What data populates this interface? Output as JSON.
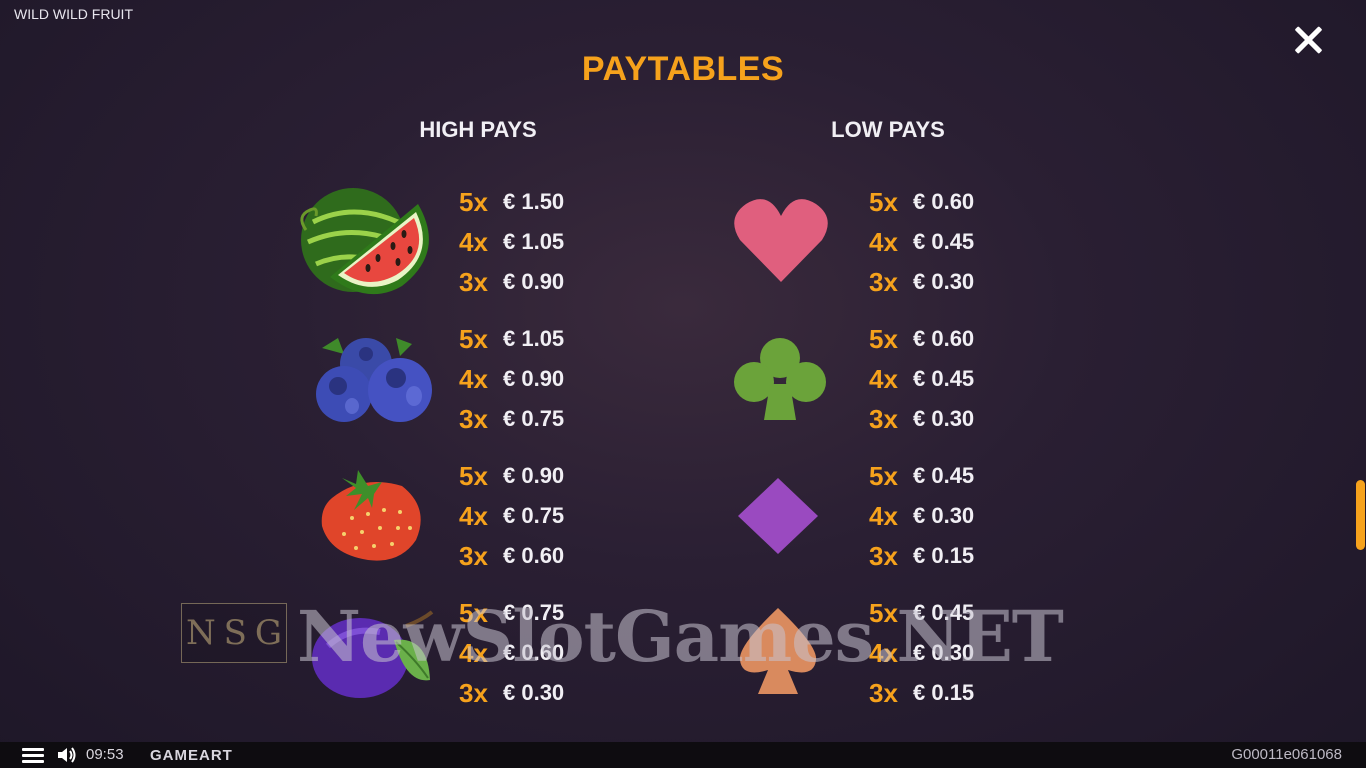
{
  "window": {
    "title": "WILD WILD FRUIT"
  },
  "page": {
    "title": "PAYTABLES"
  },
  "high_pays": {
    "title": "HIGH PAYS",
    "symbols": [
      {
        "icon": "watermelon-icon",
        "rows": [
          {
            "mult": "5x",
            "amount": "€ 1.50"
          },
          {
            "mult": "4x",
            "amount": "€ 1.05"
          },
          {
            "mult": "3x",
            "amount": "€ 0.90"
          }
        ]
      },
      {
        "icon": "blueberries-icon",
        "rows": [
          {
            "mult": "5x",
            "amount": "€ 1.05"
          },
          {
            "mult": "4x",
            "amount": "€ 0.90"
          },
          {
            "mult": "3x",
            "amount": "€ 0.75"
          }
        ]
      },
      {
        "icon": "strawberry-icon",
        "rows": [
          {
            "mult": "5x",
            "amount": "€ 0.90"
          },
          {
            "mult": "4x",
            "amount": "€ 0.75"
          },
          {
            "mult": "3x",
            "amount": "€ 0.60"
          }
        ]
      },
      {
        "icon": "plum-icon",
        "rows": [
          {
            "mult": "5x",
            "amount": "€ 0.75"
          },
          {
            "mult": "4x",
            "amount": "€ 0.60"
          },
          {
            "mult": "3x",
            "amount": "€ 0.30"
          }
        ]
      }
    ]
  },
  "low_pays": {
    "title": "LOW PAYS",
    "symbols": [
      {
        "icon": "heart-icon",
        "rows": [
          {
            "mult": "5x",
            "amount": "€ 0.60"
          },
          {
            "mult": "4x",
            "amount": "€ 0.45"
          },
          {
            "mult": "3x",
            "amount": "€ 0.30"
          }
        ]
      },
      {
        "icon": "club-icon",
        "rows": [
          {
            "mult": "5x",
            "amount": "€ 0.60"
          },
          {
            "mult": "4x",
            "amount": "€ 0.45"
          },
          {
            "mult": "3x",
            "amount": "€ 0.30"
          }
        ]
      },
      {
        "icon": "diamond-icon",
        "rows": [
          {
            "mult": "5x",
            "amount": "€ 0.45"
          },
          {
            "mult": "4x",
            "amount": "€ 0.30"
          },
          {
            "mult": "3x",
            "amount": "€ 0.15"
          }
        ]
      },
      {
        "icon": "spade-icon",
        "rows": [
          {
            "mult": "5x",
            "amount": "€ 0.45"
          },
          {
            "mult": "4x",
            "amount": "€ 0.30"
          },
          {
            "mult": "3x",
            "amount": "€ 0.15"
          }
        ]
      }
    ]
  },
  "watermark": {
    "logo_letters": [
      "N",
      "S",
      "G"
    ],
    "text": "NewSlotGames.NET"
  },
  "bottom_bar": {
    "time": "09:53",
    "brand": "GAMEART",
    "game_id": "G00011e061068"
  },
  "colors": {
    "accent": "#f6a21c",
    "text": "#f1eff4",
    "background": "#2a1f33"
  }
}
